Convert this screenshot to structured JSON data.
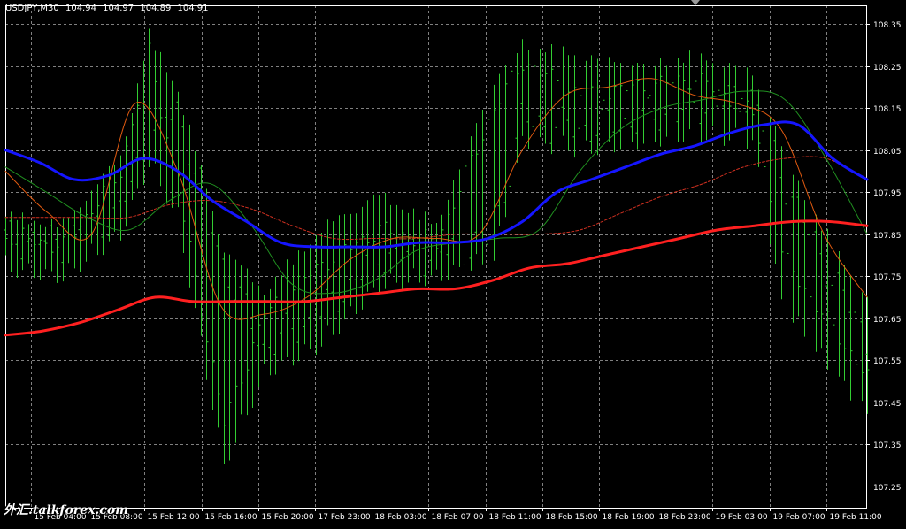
{
  "header": {
    "symbol": "USDJPY,M30",
    "open": "104.94",
    "high": "104.97",
    "low": "104.89",
    "close": "104.91"
  },
  "watermark": "外汇.talkforex.com",
  "colors": {
    "background": "#000000",
    "grid": "#808080",
    "frame": "#ffffff",
    "bars": "#32cd32",
    "ma_blue": "#1515ff",
    "ma_red": "#ff2020",
    "ma_thin_red": "#d03020",
    "ma_thin_green": "#209020",
    "ma_orange": "#e05a10"
  },
  "chart_data": {
    "type": "line",
    "ylim": [
      107.25,
      108.35
    ],
    "y_ticks": [
      "108.35",
      "108.25",
      "108.15",
      "108.05",
      "107.95",
      "107.85",
      "107.75",
      "107.65",
      "107.55",
      "107.45",
      "107.35",
      "107.25"
    ],
    "x_ticks": [
      "15 Feb 04:00",
      "15 Feb 08:00",
      "15 Feb 12:00",
      "15 Feb 16:00",
      "15 Feb 20:00",
      "17 Feb 23:00",
      "18 Feb 03:00",
      "18 Feb 07:00",
      "18 Feb 11:00",
      "18 Feb 15:00",
      "18 Feb 19:00",
      "18 Feb 23:00",
      "19 Feb 03:00",
      "19 Feb 07:00",
      "19 Feb 11:00"
    ],
    "bars_count": 151,
    "bars_range": [
      {
        "x": 0,
        "high": 107.88,
        "low": 107.8,
        "open": 107.84,
        "close": 107.85
      },
      {
        "x": 10,
        "high": 107.86,
        "low": 107.78,
        "open": 107.83,
        "close": 107.82
      },
      {
        "x": 20,
        "high": 108.02,
        "low": 107.88,
        "open": 107.9,
        "close": 108.0
      },
      {
        "x": 25,
        "high": 108.31,
        "low": 108.05,
        "open": 108.08,
        "close": 108.28
      },
      {
        "x": 30,
        "high": 108.18,
        "low": 107.92,
        "open": 108.15,
        "close": 107.95
      },
      {
        "x": 38,
        "high": 107.8,
        "low": 107.33,
        "open": 107.78,
        "close": 107.4
      },
      {
        "x": 45,
        "high": 107.7,
        "low": 107.55,
        "open": 107.58,
        "close": 107.66
      },
      {
        "x": 55,
        "high": 107.85,
        "low": 107.62,
        "open": 107.66,
        "close": 107.78
      },
      {
        "x": 65,
        "high": 107.93,
        "low": 107.76,
        "open": 107.8,
        "close": 107.86
      },
      {
        "x": 75,
        "high": 107.86,
        "low": 107.78,
        "open": 107.8,
        "close": 107.83
      },
      {
        "x": 85,
        "high": 108.2,
        "low": 107.82,
        "open": 107.84,
        "close": 108.15
      },
      {
        "x": 90,
        "high": 108.29,
        "low": 108.1,
        "open": 108.12,
        "close": 108.26
      },
      {
        "x": 100,
        "high": 108.26,
        "low": 108.08,
        "open": 108.1,
        "close": 108.18
      },
      {
        "x": 110,
        "high": 108.24,
        "low": 108.1,
        "open": 108.12,
        "close": 108.2
      },
      {
        "x": 120,
        "high": 108.26,
        "low": 108.12,
        "open": 108.15,
        "close": 108.22
      },
      {
        "x": 130,
        "high": 108.22,
        "low": 108.1,
        "open": 108.18,
        "close": 108.14
      },
      {
        "x": 135,
        "high": 108.05,
        "low": 107.72,
        "open": 108.0,
        "close": 107.8
      },
      {
        "x": 140,
        "high": 107.9,
        "low": 107.62,
        "open": 107.85,
        "close": 107.7
      },
      {
        "x": 150,
        "high": 107.68,
        "low": 107.45,
        "open": 107.6,
        "close": 107.51
      }
    ],
    "series": [
      {
        "style": "ma_blue",
        "values": [
          108.05,
          108.02,
          107.98,
          107.99,
          108.03,
          108.0,
          107.93,
          107.88,
          107.83,
          107.82,
          107.82,
          107.82,
          107.83,
          107.83,
          107.84,
          107.88,
          107.95,
          107.98,
          108.01,
          108.04,
          108.06,
          108.09,
          108.11,
          108.11,
          108.03,
          107.98
        ]
      },
      {
        "style": "ma_red",
        "values": [
          107.61,
          107.62,
          107.64,
          107.67,
          107.7,
          107.69,
          107.69,
          107.69,
          107.69,
          107.7,
          107.71,
          107.72,
          107.72,
          107.74,
          107.77,
          107.78,
          107.8,
          107.82,
          107.84,
          107.86,
          107.87,
          107.88,
          107.88,
          107.87
        ]
      },
      {
        "style": "ma_thin_red",
        "values": [
          107.89,
          107.89,
          107.89,
          107.89,
          107.92,
          107.93,
          107.91,
          107.87,
          107.84,
          107.84,
          107.84,
          107.85,
          107.85,
          107.85,
          107.86,
          107.9,
          107.94,
          107.97,
          108.01,
          108.03,
          108.03,
          107.98
        ]
      },
      {
        "style": "ma_thin_green",
        "values": [
          108.01,
          107.95,
          107.89,
          107.86,
          107.93,
          107.97,
          107.87,
          107.73,
          107.71,
          107.74,
          107.81,
          107.83,
          107.84,
          107.86,
          108.0,
          108.1,
          108.15,
          108.17,
          108.19,
          108.17,
          108.03,
          107.85
        ]
      },
      {
        "style": "ma_orange",
        "values": [
          108.0,
          107.9,
          107.85,
          108.16,
          108.0,
          107.68,
          107.66,
          107.7,
          107.79,
          107.84,
          107.84,
          107.85,
          108.05,
          108.18,
          108.2,
          108.22,
          108.18,
          108.16,
          108.1,
          107.85,
          107.7
        ]
      }
    ]
  }
}
